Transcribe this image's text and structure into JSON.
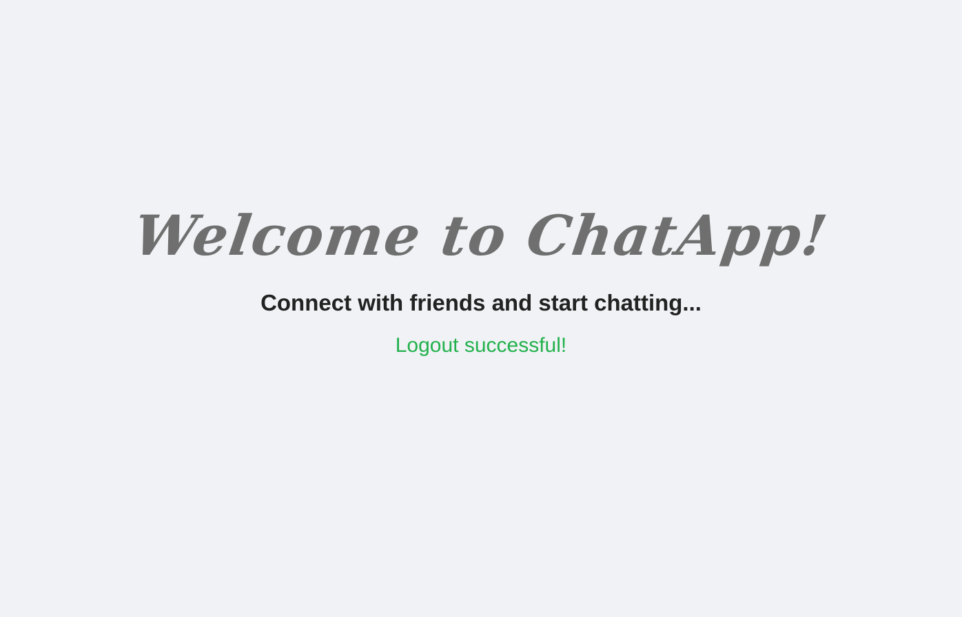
{
  "welcome": {
    "title": "Welcome to ChatApp!",
    "subtitle": "Connect with friends and start chatting...",
    "status_message": "Logout successful!"
  },
  "colors": {
    "background": "#f0f2f5",
    "title": "#6f6f6f",
    "subtitle": "#222222",
    "status_success": "#22b14c"
  }
}
